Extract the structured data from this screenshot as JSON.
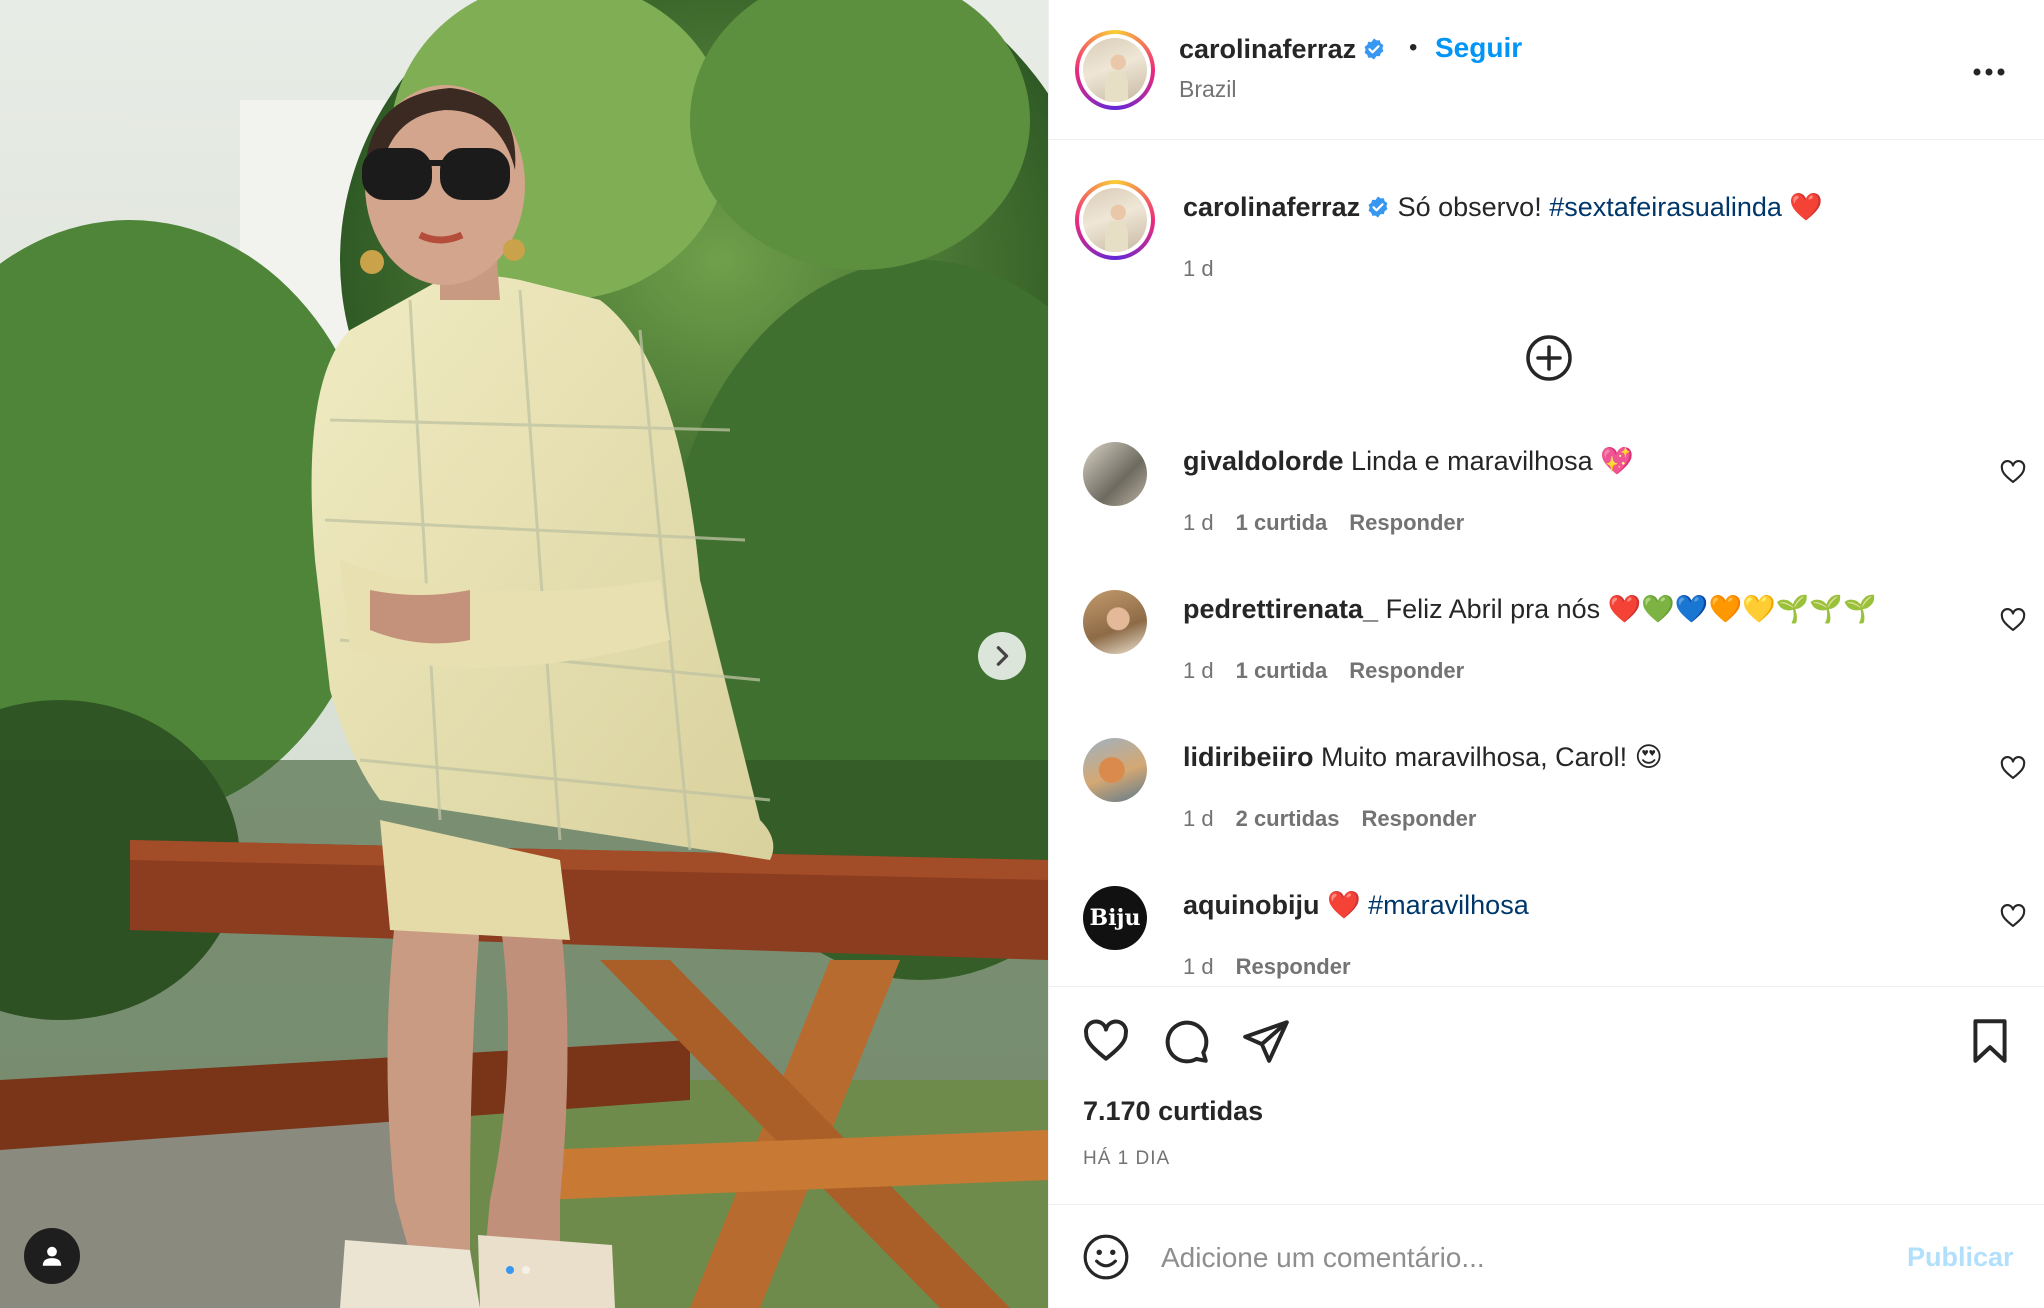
{
  "post": {
    "author": "carolinaferraz",
    "location": "Brazil",
    "follow_label": "Seguir",
    "separator": "•",
    "caption_text": "Só observo!",
    "caption_hashtag": "#sextafeirasualinda",
    "caption_emoji": "❤️",
    "caption_time": "1 d"
  },
  "comments": [
    {
      "user": "givaldolorde",
      "text": "Linda e maravilhosa 💖",
      "hashtag": "",
      "time": "1 d",
      "likes": "1 curtida",
      "reply": "Responder"
    },
    {
      "user": "pedrettirenata_",
      "text": "Feliz Abril pra nós ❤️💚💙🧡💛🌱🌱🌱",
      "hashtag": "",
      "time": "1 d",
      "likes": "1 curtida",
      "reply": "Responder"
    },
    {
      "user": "lidiribeiiro",
      "text": "Muito maravilhosa, Carol! 😍",
      "hashtag": "",
      "time": "1 d",
      "likes": "2 curtidas",
      "reply": "Responder"
    },
    {
      "user": "aquinobiju",
      "text": "❤️",
      "hashtag": "#maravilhosa",
      "time": "1 d",
      "likes": "",
      "reply": "Responder"
    }
  ],
  "engagement": {
    "likes_count": "7.170 curtidas",
    "posted_ago": "HÁ 1 DIA"
  },
  "composer": {
    "placeholder": "Adicione um comentário...",
    "publish_label": "Publicar"
  },
  "badges": {
    "biju_avatar_text": "Biju"
  },
  "icons": [
    "verified-badge-icon",
    "more-options-icon",
    "load-more-comments-icon",
    "heart-icon",
    "comment-icon",
    "share-icon",
    "bookmark-icon",
    "emoji-icon",
    "next-arrow-icon",
    "user-tag-icon"
  ],
  "colors": {
    "link_blue": "#0095f6",
    "hashtag_blue": "#00376b",
    "verified_blue": "#3897f0",
    "muted_text": "#737373",
    "publish_disabled": "#b2dffc"
  }
}
